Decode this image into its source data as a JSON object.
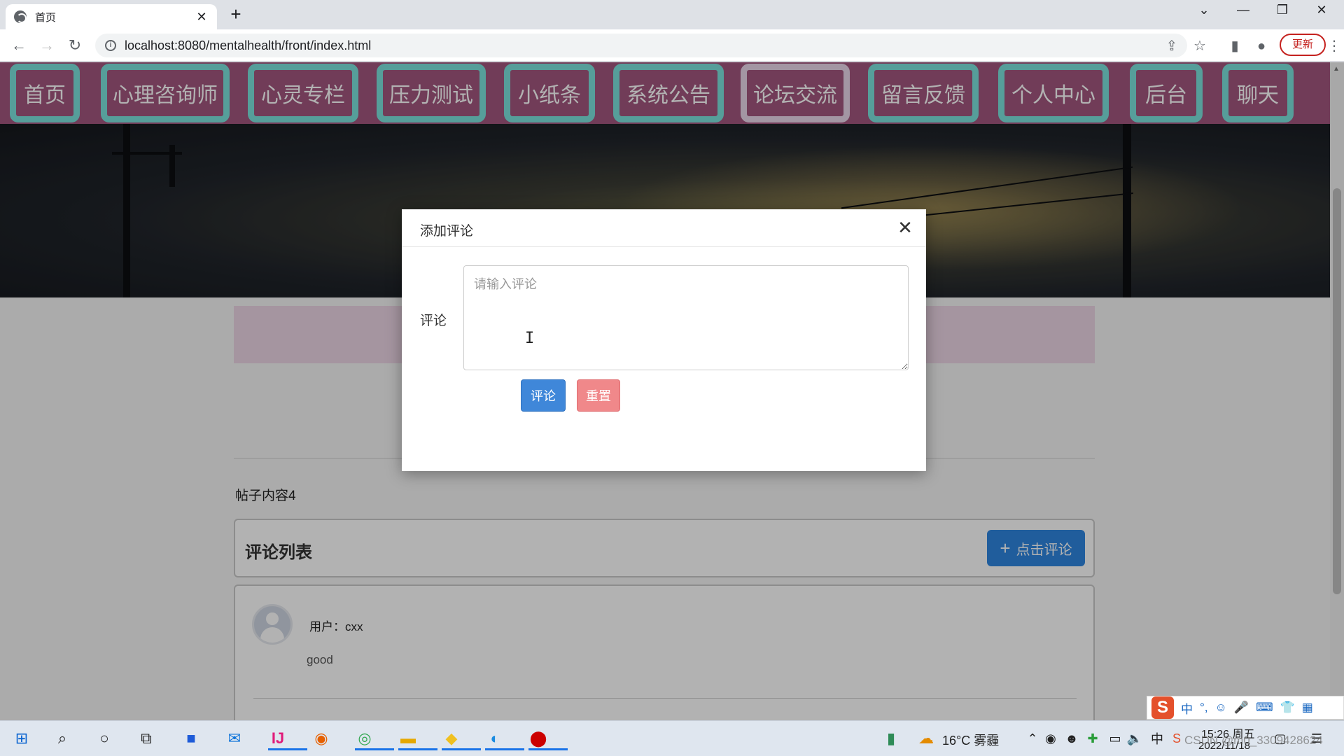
{
  "browser": {
    "tab_title": "首页",
    "url": "localhost:8080/mentalhealth/front/index.html",
    "update_label": "更新",
    "accent_color": "#c5221f"
  },
  "nav": {
    "items": [
      {
        "label": "首页"
      },
      {
        "label": "心理咨询师"
      },
      {
        "label": "心灵专栏"
      },
      {
        "label": "压力测试"
      },
      {
        "label": "小纸条"
      },
      {
        "label": "系统公告"
      },
      {
        "label": "论坛交流",
        "active": true
      },
      {
        "label": "留言反馈"
      },
      {
        "label": "个人中心"
      },
      {
        "label": "后台"
      },
      {
        "label": "聊天"
      }
    ],
    "background_color": "#a2577e",
    "border_color": "#7be3dd"
  },
  "post": {
    "content": "帖子内容4"
  },
  "comments": {
    "header": "评论列表",
    "add_button_label": "点击评论",
    "items": [
      {
        "user": "用户：cxx",
        "text": "good"
      }
    ]
  },
  "modal": {
    "title": "添加评论",
    "field_label": "评论",
    "placeholder": "请输入评论",
    "value": "",
    "submit_label": "评论",
    "reset_label": "重置"
  },
  "taskbar": {
    "weather": "16°C 雾霾",
    "time": "15:26 周五",
    "date": "2022/11/18",
    "ime_label": "中",
    "watermark": "CSDN @m0_3309428624"
  }
}
